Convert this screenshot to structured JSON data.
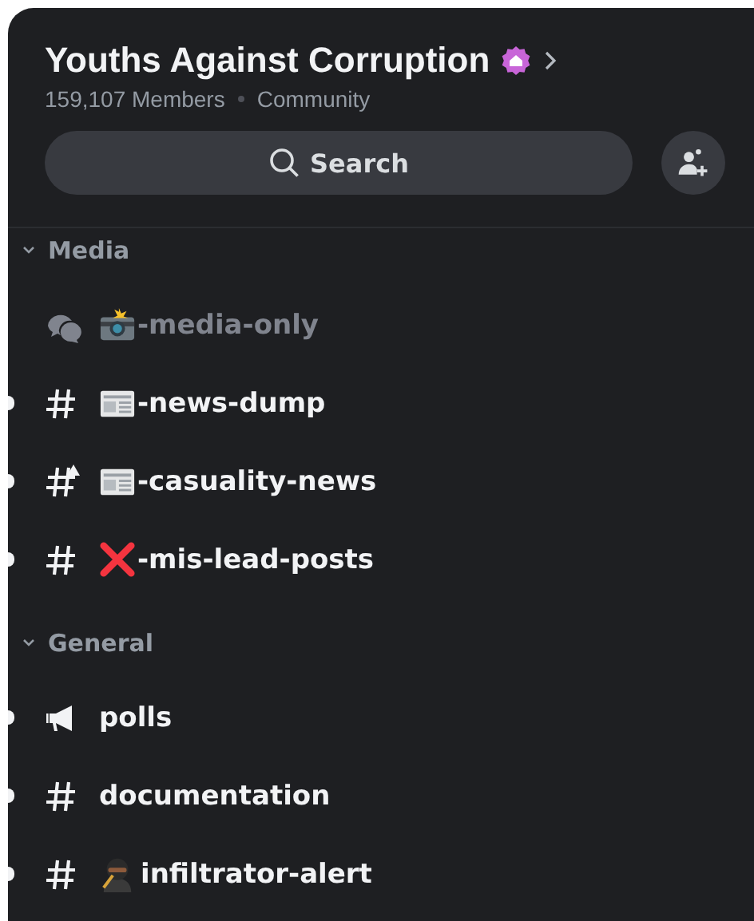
{
  "server": {
    "name": "Youths Against Corruption",
    "members": "159,107 Members",
    "type": "Community"
  },
  "search": {
    "placeholder": "Search"
  },
  "categories": [
    {
      "name": "Media",
      "expanded": true,
      "channels": [
        {
          "kind": "forum",
          "emoji": {
            "kind": "camera"
          },
          "name": "-media-only",
          "unread": false
        },
        {
          "kind": "text",
          "emoji": {
            "kind": "newspaper"
          },
          "name": "-news-dump",
          "unread": true
        },
        {
          "kind": "text-alert",
          "emoji": {
            "kind": "newspaper"
          },
          "name": "-casuality-news",
          "unread": true
        },
        {
          "kind": "text",
          "emoji": {
            "kind": "cross"
          },
          "name": "-mis-lead-posts",
          "unread": true
        }
      ]
    },
    {
      "name": "General",
      "expanded": true,
      "channels": [
        {
          "kind": "announcement",
          "name": "polls",
          "unread": true
        },
        {
          "kind": "text",
          "name": "documentation",
          "unread": true
        },
        {
          "kind": "text",
          "emoji": {
            "kind": "ninja"
          },
          "name": "infiltrator-alert",
          "unread": true
        }
      ]
    }
  ]
}
